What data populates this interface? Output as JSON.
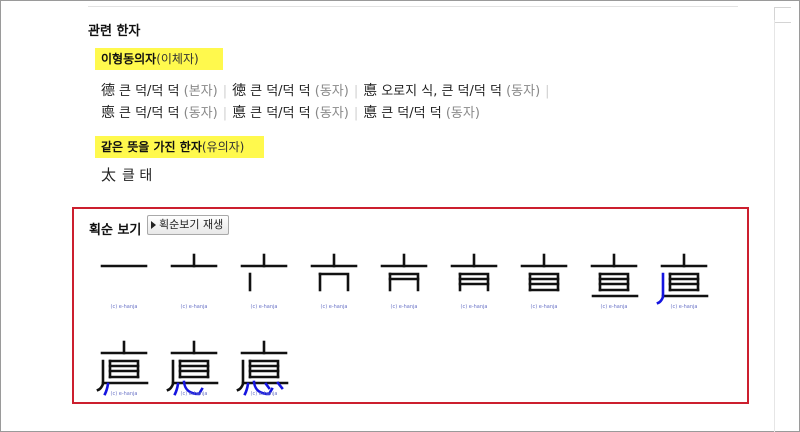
{
  "section_title": "관련 한자",
  "variants": {
    "heading_bold": "이형동의자",
    "heading_paren": "(이체자)",
    "rows": [
      [
        {
          "han": "德",
          "reading": "큰 덕/덕 덕",
          "note": "(본자)"
        },
        {
          "han": "徳",
          "reading": "큰 덕/덕 덕",
          "note": "(동자)"
        },
        {
          "han": "悳",
          "reading": "오로지 식, 큰 덕/덕 덕",
          "note": "(동자)"
        }
      ],
      [
        {
          "han": "㥁",
          "reading": "큰 덕/덕 덕",
          "note": "(동자)"
        },
        {
          "han": "悳",
          "reading": "큰 덕/덕 덕",
          "note": "(동자)"
        },
        {
          "han": "悳",
          "reading": "큰 덕/덕 덕",
          "note": "(동자)"
        }
      ]
    ]
  },
  "synonyms": {
    "heading_bold": "같은 뜻을 가진 한자",
    "heading_paren": "(유의자)",
    "item_han": "太",
    "item_reading": "클 태"
  },
  "stroke_order": {
    "title": "획순 보기",
    "play_label": "획순보기 재생",
    "credit": "(c) e-hanja",
    "step_count": 12,
    "new_stroke_color": "#1515e0",
    "old_stroke_color": "#111111"
  }
}
